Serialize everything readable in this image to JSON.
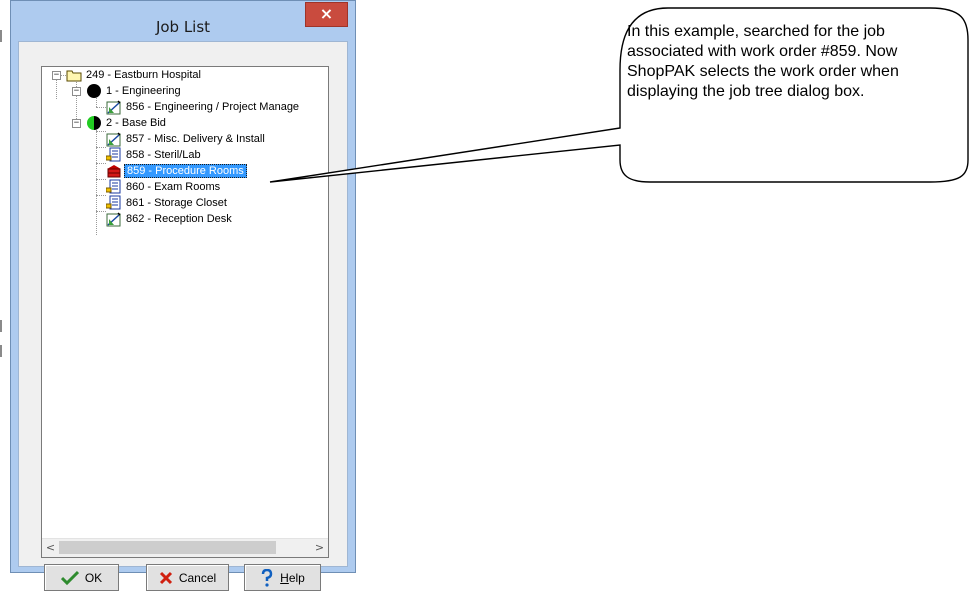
{
  "dialog": {
    "title": "Job List",
    "close_label": "×"
  },
  "tree": {
    "root": {
      "label": "249 - Eastburn Hospital",
      "expander": "−"
    },
    "groups": [
      {
        "label": "1 - Engineering",
        "expander": "−",
        "status": "black",
        "items": [
          {
            "label": "856 - Engineering / Project Manage",
            "icon": "drafting-icon"
          }
        ]
      },
      {
        "label": "2 - Base Bid",
        "expander": "−",
        "status": "green-black",
        "items": [
          {
            "label": "857 - Misc. Delivery & Install",
            "icon": "drafting-icon"
          },
          {
            "label": "858 - Steril/Lab",
            "icon": "document-hand-icon"
          },
          {
            "label": "859 - Procedure Rooms",
            "icon": "red-cabinet-icon",
            "selected": true
          },
          {
            "label": "860 - Exam Rooms",
            "icon": "document-hand-icon"
          },
          {
            "label": "861 - Storage Closet",
            "icon": "document-hand-icon"
          },
          {
            "label": "862 - Reception Desk",
            "icon": "drafting-icon"
          }
        ]
      }
    ]
  },
  "scrollbar": {
    "left_arrow": "<",
    "right_arrow": ">"
  },
  "buttons": {
    "ok": {
      "label": "OK",
      "icon": "checkmark-icon"
    },
    "cancel": {
      "label": "Cancel",
      "icon": "red-x-icon"
    },
    "help": {
      "prefix": "",
      "underlined": "H",
      "rest": "elp",
      "icon": "question-icon"
    }
  },
  "callout": {
    "text": "In this example, searched for the job associated with work order #859.  Now ShopPAK selects the work order when displaying the job tree dialog box."
  },
  "colors": {
    "selection": "#3399ff",
    "dialog_frame": "#aecbef",
    "close_button": "#c94b3e",
    "ok_check": "#2e8b2e",
    "cancel_x": "#d02010",
    "help_question": "#1060c0"
  }
}
